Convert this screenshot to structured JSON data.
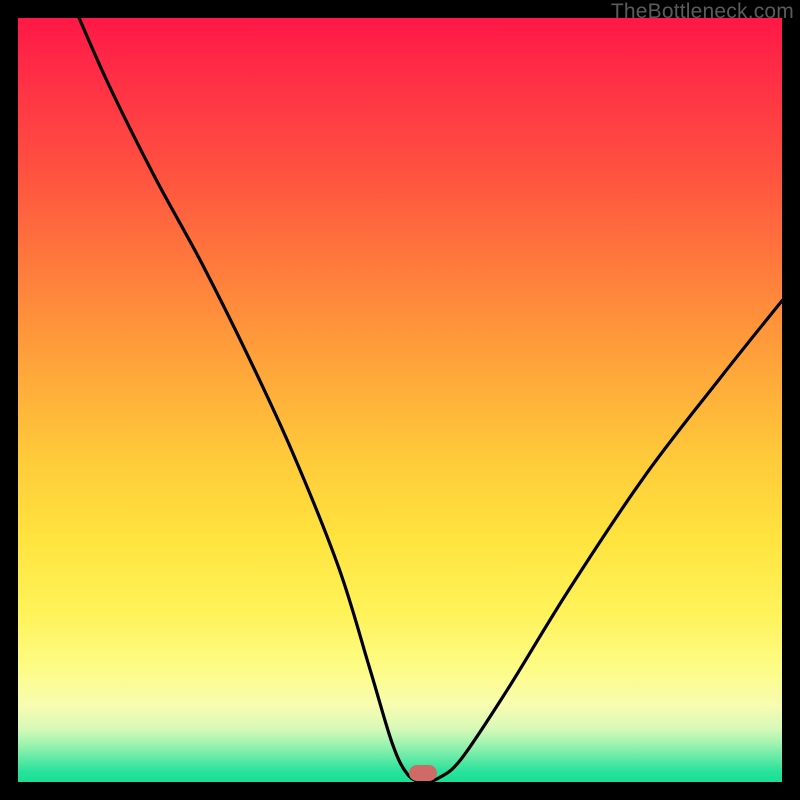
{
  "watermark": "TheBottleneck.com",
  "marker": {
    "x_pct": 53,
    "y_pct": 100
  },
  "chart_data": {
    "type": "line",
    "title": "",
    "xlabel": "",
    "ylabel": "",
    "xlim": [
      0,
      100
    ],
    "ylim": [
      0,
      100
    ],
    "series": [
      {
        "name": "bottleneck-curve",
        "x": [
          8,
          12,
          18,
          24,
          30,
          36,
          42,
          46,
          49,
          51,
          53,
          55,
          58,
          64,
          72,
          82,
          92,
          100
        ],
        "y": [
          100,
          91,
          79,
          68,
          56,
          43,
          28,
          15,
          5,
          1,
          0,
          0.5,
          3,
          12,
          25,
          40,
          53,
          63
        ]
      }
    ],
    "annotations": [
      {
        "type": "marker",
        "x": 53,
        "y": 0,
        "shape": "pill",
        "color": "#cf6a67"
      }
    ],
    "background_gradient": {
      "direction": "vertical",
      "stops": [
        {
          "pct": 0,
          "color": "#ff1846"
        },
        {
          "pct": 50,
          "color": "#ffb13a"
        },
        {
          "pct": 80,
          "color": "#fff566"
        },
        {
          "pct": 100,
          "color": "#17df95"
        }
      ]
    }
  }
}
